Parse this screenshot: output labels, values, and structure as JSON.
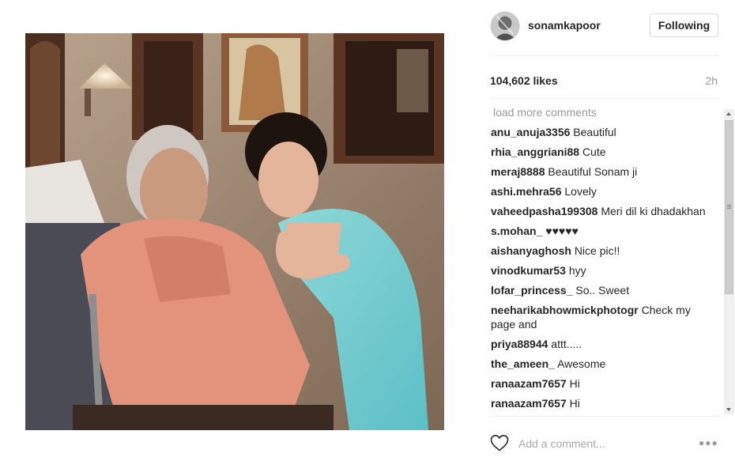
{
  "post": {
    "username": "sonamkapoor",
    "follow_label": "Following",
    "likes": "104,602 likes",
    "time": "2h",
    "load_more": "load more comments",
    "comment_placeholder": "Add a comment...",
    "more_icon": "more-options-icon",
    "heart_icon": "heart-outline-icon"
  },
  "comments": [
    {
      "user": "anu_anuja3356",
      "text": "Beautiful"
    },
    {
      "user": "rhia_anggriani88",
      "text": "Cute"
    },
    {
      "user": "meraj8888",
      "text": "Beautiful Sonam ji"
    },
    {
      "user": "ashi.mehra56",
      "text": "Lovely"
    },
    {
      "user": "vaheedpasha199308",
      "text": "Meri dil ki dhadakhan"
    },
    {
      "user": "s.mohan_",
      "text": "♥♥♥♥♥"
    },
    {
      "user": "aishanyaghosh",
      "text": "Nice pic!!"
    },
    {
      "user": "vinodkumar53",
      "text": "hyy"
    },
    {
      "user": "lofar_princess_",
      "text": "So.. Sweet"
    },
    {
      "user": "neeharikabhowmickphotogr",
      "text": "Check my page and"
    },
    {
      "user": "priya88944",
      "text": "attt....."
    },
    {
      "user": "the_ameen_",
      "text": "Awesome"
    },
    {
      "user": "ranaazam7657",
      "text": "Hi"
    },
    {
      "user": "ranaazam7657",
      "text": "Hi"
    }
  ],
  "colors": {
    "text": "#262626",
    "muted": "#999999",
    "border": "#dbdbdb"
  }
}
